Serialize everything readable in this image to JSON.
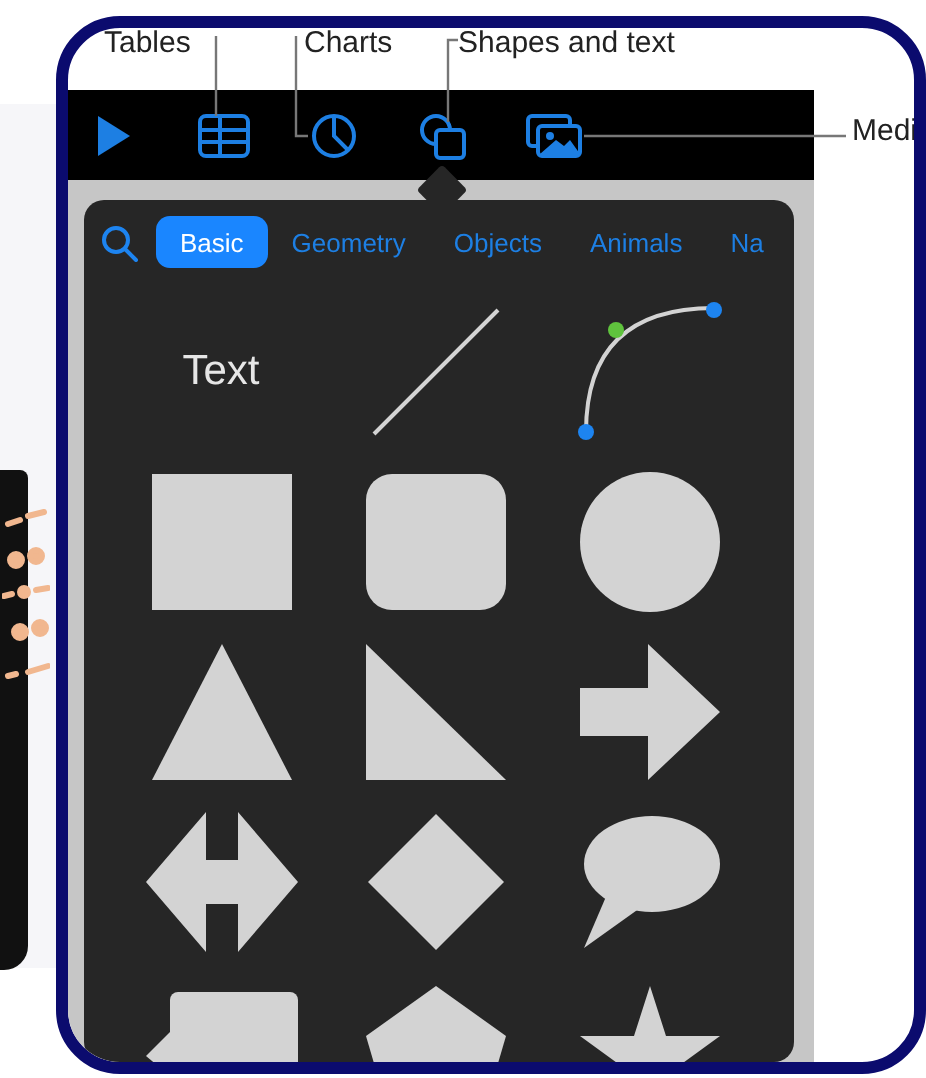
{
  "callouts": [
    {
      "label": "Tables"
    },
    {
      "label": "Charts"
    },
    {
      "label": "Shapes and text"
    },
    {
      "label": "Medi"
    }
  ],
  "toolbar": [
    {
      "kind": "play",
      "selected": false
    },
    {
      "kind": "table",
      "selected": false
    },
    {
      "kind": "chart",
      "selected": false
    },
    {
      "kind": "shapes",
      "selected": true
    },
    {
      "kind": "media",
      "selected": false
    }
  ],
  "tabs": [
    {
      "label": "Basic",
      "selected": true
    },
    {
      "label": "Geometry",
      "selected": false
    },
    {
      "label": "Objects",
      "selected": false
    },
    {
      "label": "Animals",
      "selected": false
    },
    {
      "label": "Na",
      "selected": false
    }
  ],
  "shapes": [
    {
      "kind": "text",
      "label": "Text"
    },
    {
      "kind": "line"
    },
    {
      "kind": "curve"
    },
    {
      "kind": "square"
    },
    {
      "kind": "rounded-square"
    },
    {
      "kind": "circle"
    },
    {
      "kind": "triangle"
    },
    {
      "kind": "right-triangle"
    },
    {
      "kind": "arrow"
    },
    {
      "kind": "double-arrow"
    },
    {
      "kind": "diamond"
    },
    {
      "kind": "speech-bubble"
    },
    {
      "kind": "callout-square"
    },
    {
      "kind": "pentagon"
    },
    {
      "kind": "star"
    }
  ]
}
